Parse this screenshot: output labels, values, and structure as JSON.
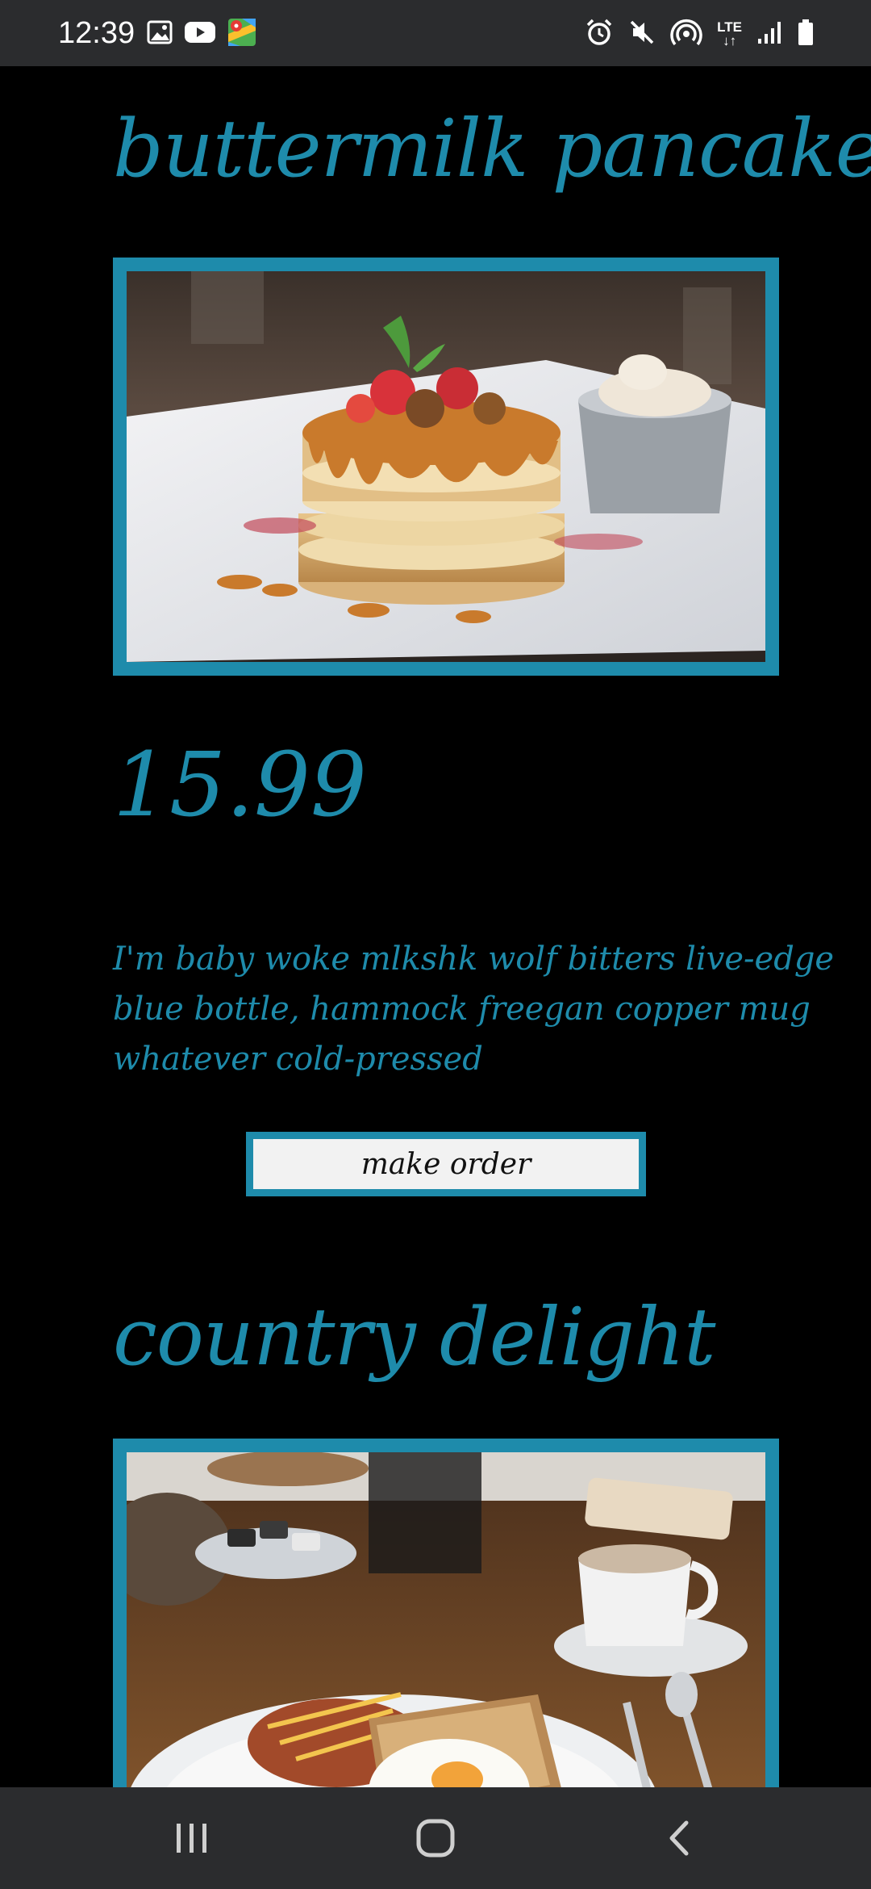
{
  "status_bar": {
    "time": "12:39",
    "left_icons": [
      "gallery-icon",
      "youtube-icon",
      "maps-icon"
    ],
    "right_icons": [
      "alarm-icon",
      "mute-icon",
      "hotspot-icon",
      "lte-icon",
      "signal-icon",
      "battery-icon"
    ],
    "network_label": "LTE"
  },
  "menu": {
    "items": [
      {
        "title": "buttermilk pancakes",
        "photo": "pancakes-photo",
        "price": "15.99",
        "description": "I'm baby woke mlkshk wolf bitters live-edge blue bottle, hammock freegan copper mug whatever cold-pressed",
        "order_label": "make order"
      },
      {
        "title": "country delight",
        "photo": "breakfast-photo"
      }
    ]
  },
  "nav_bar": {
    "buttons": [
      "recent-apps-icon",
      "home-icon",
      "back-icon"
    ]
  },
  "colors": {
    "accent": "#1e8bab",
    "background": "#000000",
    "bar": "#2b2c2e",
    "button_fill": "#f2f2f2"
  }
}
